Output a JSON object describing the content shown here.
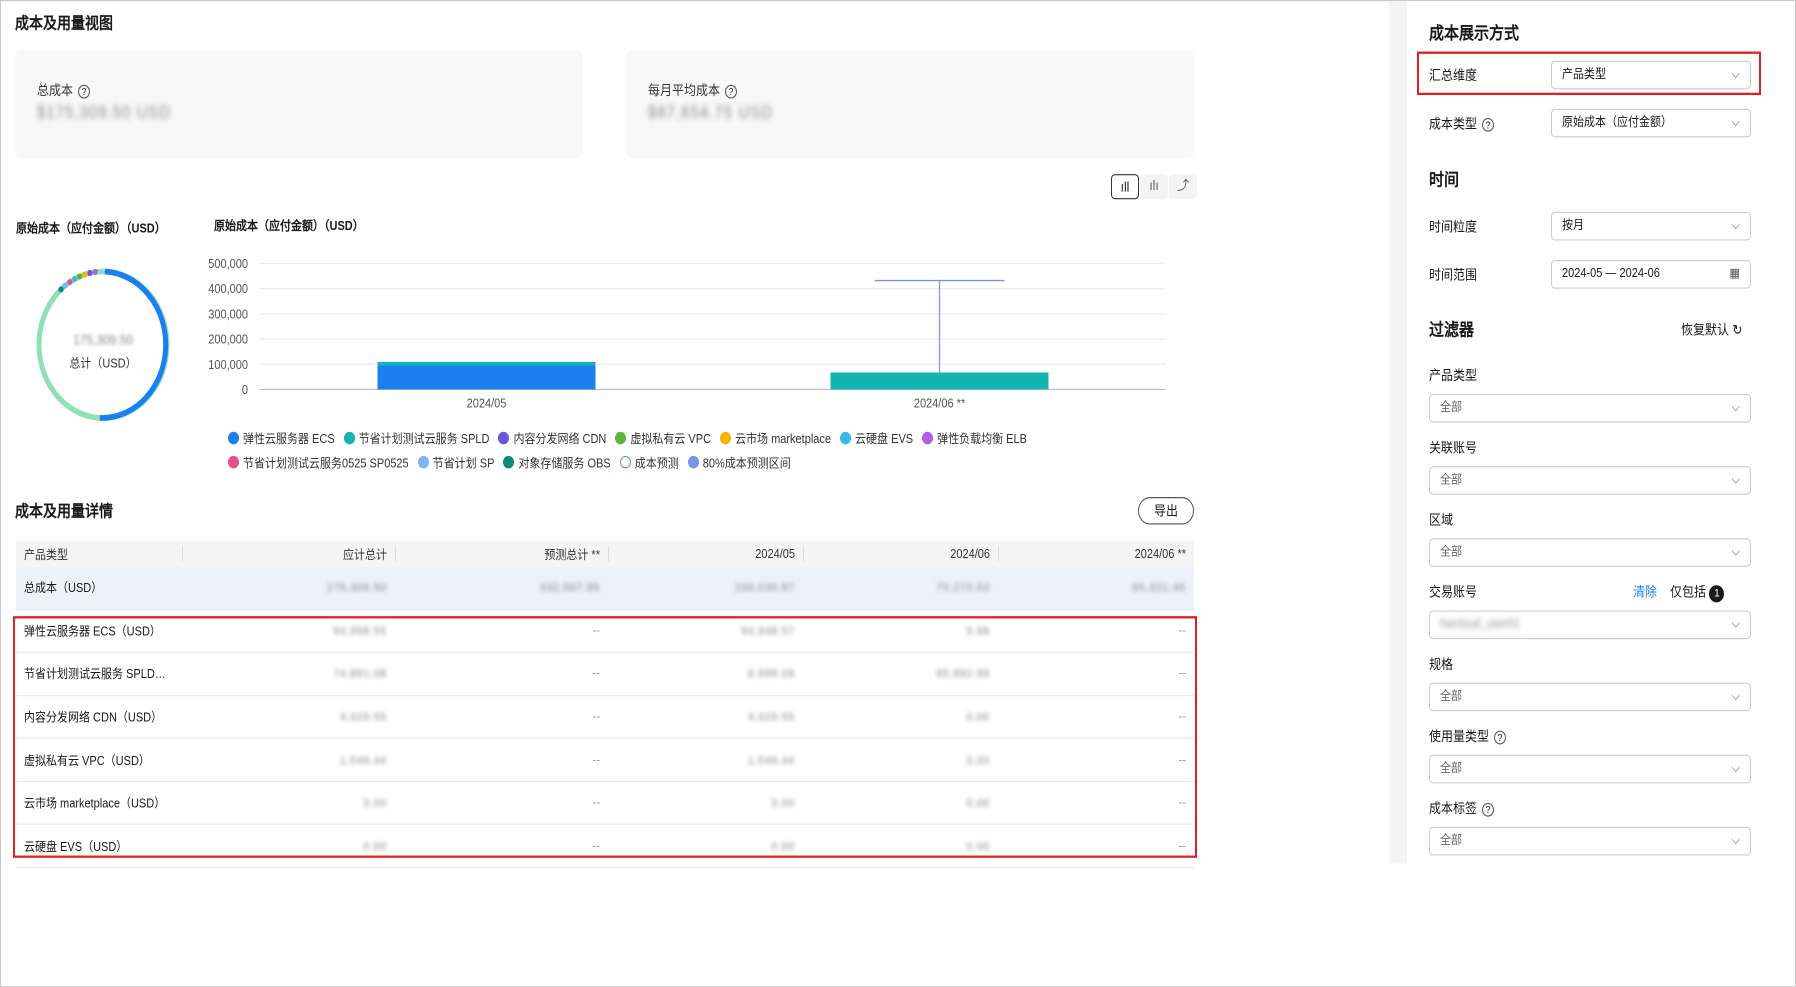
{
  "page_title": "成本及用量视图",
  "summary": {
    "total_cost_label": "总成本",
    "total_cost_value": "$175,309.50 USD",
    "monthly_avg_label": "每月平均成本",
    "monthly_avg_value": "$87,654.75 USD"
  },
  "chart_toggle": {
    "bar_label": "ıll",
    "stacked_label": "ılı",
    "line_label": "⤴"
  },
  "donut": {
    "title": "原始成本（应付金额）（USD）",
    "center_value": "175,309.50",
    "center_label": "总计（USD）"
  },
  "bar_chart_title": "原始成本（应付金额）（USD）",
  "chart_data": {
    "type": "bar",
    "categories": [
      "2024/05",
      "2024/06 **"
    ],
    "y_ticks": [
      "500,000",
      "400,000",
      "300,000",
      "200,000",
      "100,000",
      "0"
    ],
    "ylim": [
      0,
      500000
    ],
    "series": [
      {
        "name": "弹性云服务器 ECS",
        "color": "#1a7ff0",
        "values": [
          95000,
          0
        ]
      },
      {
        "name": "节省计划测试云服务 SPLD",
        "color": "#13b5b1",
        "values": [
          14000,
          67000
        ]
      }
    ],
    "forecast_interval": {
      "category_index": 1,
      "low": 67000,
      "high": 432000
    },
    "legend": [
      {
        "name": "弹性云服务器 ECS",
        "color": "#1a7ff0"
      },
      {
        "name": "节省计划测试云服务 SPLD",
        "color": "#13b5b1"
      },
      {
        "name": "内容分发网络 CDN",
        "color": "#6c52e0"
      },
      {
        "name": "虚拟私有云 VPC",
        "color": "#5db535"
      },
      {
        "name": "云市场 marketplace",
        "color": "#f5b400"
      },
      {
        "name": "云硬盘 EVS",
        "color": "#36b7ef"
      },
      {
        "name": "弹性负载均衡 ELB",
        "color": "#b45ee8"
      },
      {
        "name": "节省计划测试云服务0525 SP0525",
        "color": "#e84d8a"
      },
      {
        "name": "节省计划 SP",
        "color": "#7eb6f2"
      },
      {
        "name": "对象存储服务 OBS",
        "color": "#0f8a78"
      },
      {
        "name": "成本预测",
        "color": "#ffffff",
        "outline": "#6d8ff0"
      },
      {
        "name": "80%成本预测区间",
        "color": "#7b92ea"
      }
    ]
  },
  "details": {
    "title": "成本及用量详情",
    "export_label": "导出",
    "columns": [
      "产品类型",
      "应计总计",
      "预测总计 **",
      "2024/05",
      "2024/06",
      "2024/06 **"
    ],
    "total_row": [
      "总成本（USD）",
      "175,309.50",
      "432,567.89",
      "100,035.87",
      "75,273.63",
      "65,321.45"
    ],
    "rows": [
      [
        "弹性云服务器 ECS（USD）",
        "94,958.55",
        "--",
        "94,948.57",
        "9.98",
        "--"
      ],
      [
        "节省计划测试云服务 SPLD（USD）",
        "74,891.08",
        "--",
        "6,998.09",
        "65,892.99",
        "--"
      ],
      [
        "内容分发网络 CDN（USD）",
        "4,029.55",
        "--",
        "4,029.55",
        "0.00",
        "--"
      ],
      [
        "虚拟私有云 VPC（USD）",
        "1,549.44",
        "--",
        "1,549.44",
        "0.00",
        "--"
      ],
      [
        "云市场 marketplace（USD）",
        "0.00",
        "--",
        "0.00",
        "0.00",
        "--"
      ],
      [
        "云硬盘 EVS（USD）",
        "0.00",
        "--",
        "0.00",
        "0.00",
        "--"
      ]
    ]
  },
  "sidebar": {
    "display_title": "成本展示方式",
    "agg_label": "汇总维度",
    "agg_value": "产品类型",
    "cost_type_label": "成本类型",
    "cost_type_value": "原始成本（应付金额）",
    "time_title": "时间",
    "granularity_label": "时间粒度",
    "granularity_value": "按月",
    "range_label": "时间范围",
    "range_value": "2024-05 — 2024-06",
    "filter_title": "过滤器",
    "reset_label": "恢复默认",
    "product_label": "产品类型",
    "product_value": "全部",
    "linked_label": "关联账号",
    "linked_value": "全部",
    "region_label": "区域",
    "region_value": "全部",
    "trade_label": "交易账号",
    "trade_clear": "清除",
    "trade_include": "仅包括",
    "trade_count": "1",
    "trade_value": "hwcloud_user01",
    "spec_label": "规格",
    "spec_value": "全部",
    "usage_label": "使用量类型",
    "usage_value": "全部",
    "tag_label": "成本标签",
    "tag_value": "全部"
  }
}
